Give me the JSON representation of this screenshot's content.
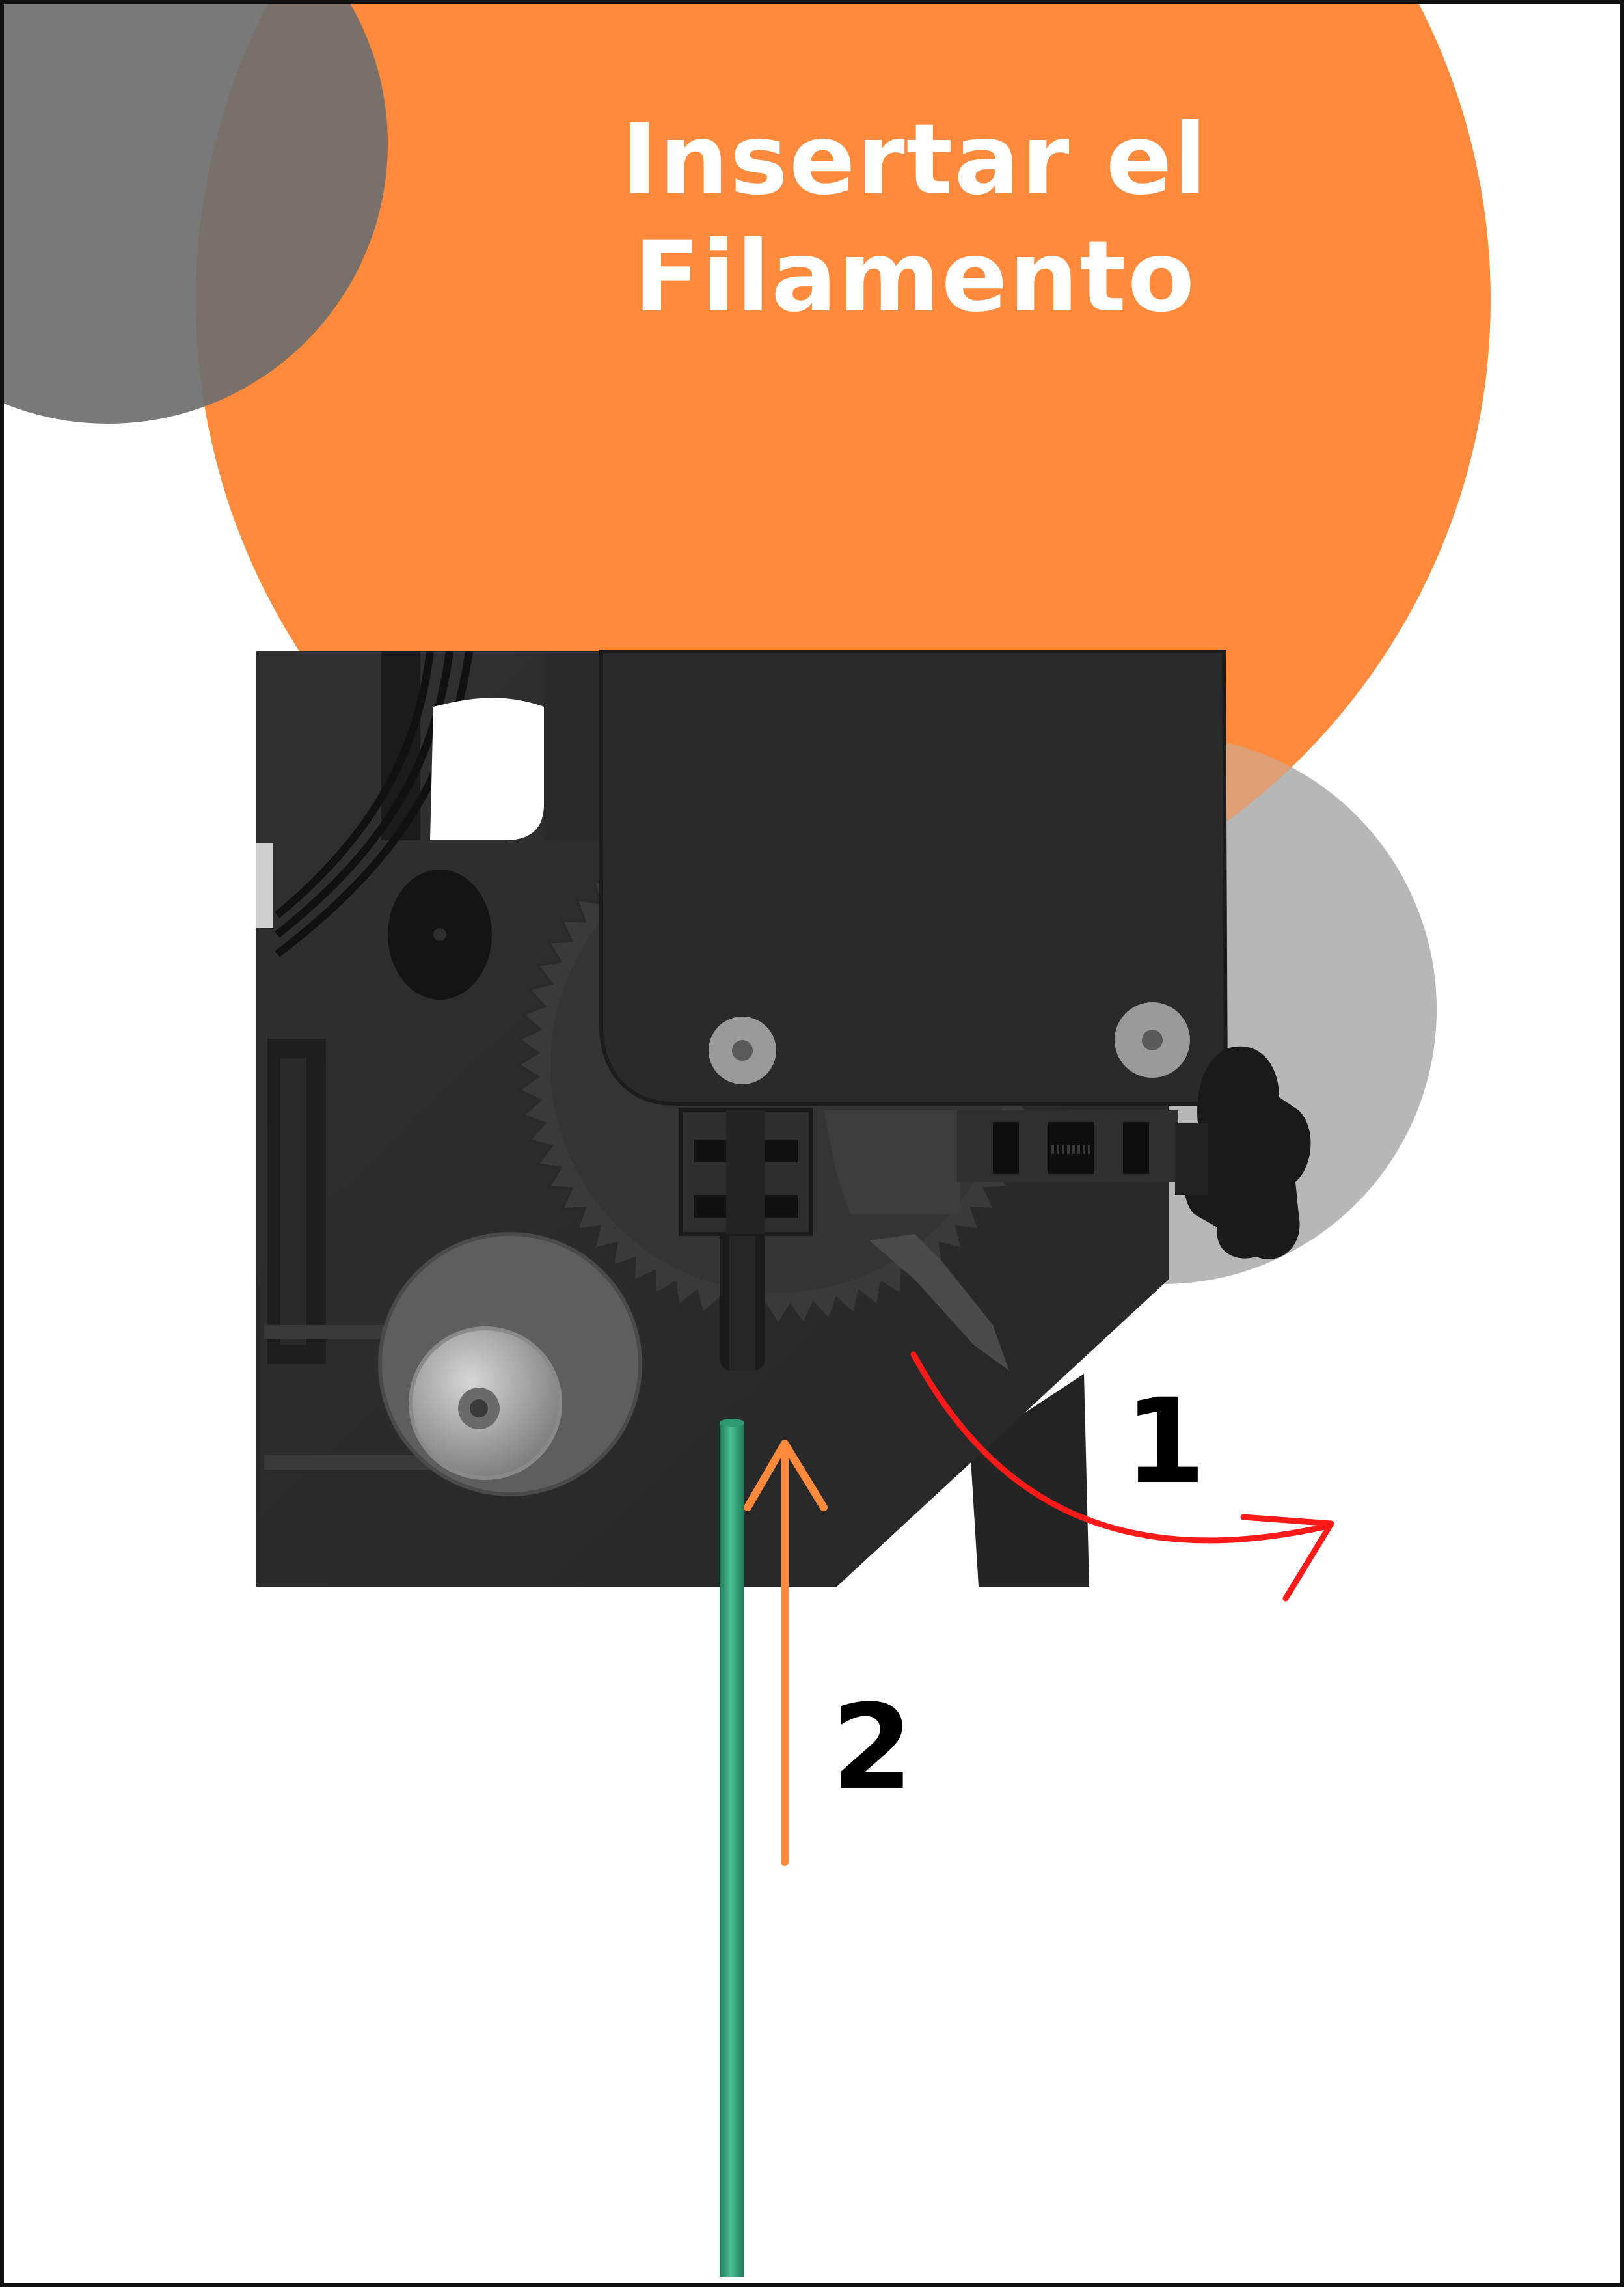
{
  "title": {
    "line1": "Insertar el",
    "line2": "Filamento"
  },
  "steps": [
    {
      "label": "1",
      "action": "lever-release",
      "arrow_color": "#ff1a1a"
    },
    {
      "label": "2",
      "action": "push-filament-up",
      "arrow_color": "#ff8a3c"
    }
  ],
  "colors": {
    "accent_orange": "#ff8a3c",
    "circle_gray_dark": "#6e6e6e",
    "circle_gray_light": "#b7b7b7",
    "extruder_body": "#2c2c2c",
    "filament": "#2e9a73"
  },
  "icons": [
    "extruder-icon",
    "filament-icon",
    "tension-knob-icon",
    "gear-icon",
    "pulley-icon"
  ]
}
